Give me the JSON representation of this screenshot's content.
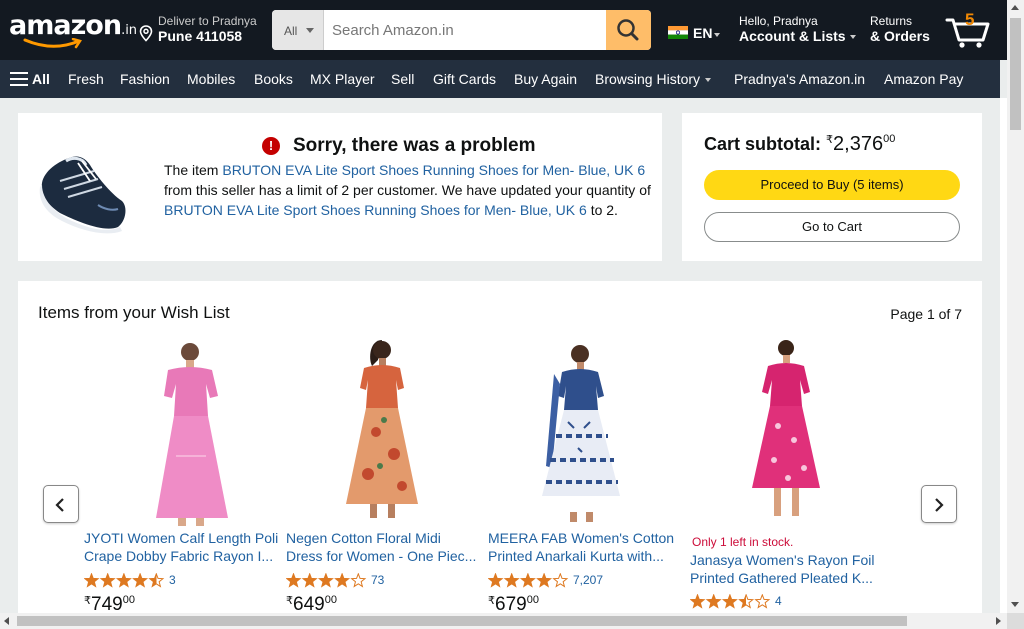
{
  "header": {
    "logo_text": "amazon",
    "logo_suffix": ".in",
    "deliver_line1": "Deliver to Pradnya",
    "deliver_line2": "Pune 411058",
    "search_category": "All",
    "search_placeholder": "Search Amazon.in",
    "language": "EN",
    "account_line1": "Hello, Pradnya",
    "account_line2": "Account & Lists",
    "returns_line1": "Returns",
    "returns_line2": "& Orders",
    "cart_count": "5"
  },
  "nav": {
    "all": "All",
    "items": [
      "Fresh",
      "Fashion",
      "Mobiles",
      "Books",
      "MX Player",
      "Sell",
      "Gift Cards",
      "Buy Again",
      "Browsing History",
      "Pradnya's Amazon.in",
      "Amazon Pay"
    ]
  },
  "alert": {
    "title": "Sorry, there was a problem",
    "text_1": "The item ",
    "product_link_1": "BRUTON EVA Lite Sport Shoes Running Shoes for Men- Blue, UK 6",
    "text_2": " from this seller has a limit of 2 per customer. We have updated your quantity of ",
    "product_link_2": "BRUTON EVA Lite Sport Shoes Running Shoes for Men- Blue, UK 6",
    "text_3": " to 2."
  },
  "cart_box": {
    "subtotal_label": "Cart subtotal:",
    "currency": "₹",
    "amount": "2,376",
    "fraction": "00",
    "proceed_label": "Proceed to Buy (5 items)",
    "goto_cart_label": "Go to Cart"
  },
  "wishlist": {
    "title": "Items from your Wish List",
    "page_label": "Page 1 of 7",
    "products": [
      {
        "name_line1": "JYOTI Women Calf Length Poli",
        "name_line2": "Crape Dobby Fabric Rayon I...",
        "rating": 4.5,
        "reviews": "3",
        "currency": "₹",
        "price": "749",
        "fraction": "00",
        "stock": ""
      },
      {
        "name_line1": "Negen Cotton Floral Midi",
        "name_line2": "Dress for Women - One Piec...",
        "rating": 4.0,
        "reviews": "73",
        "currency": "₹",
        "price": "649",
        "fraction": "00",
        "stock": ""
      },
      {
        "name_line1": "MEERA FAB Women's Cotton",
        "name_line2": "Printed Anarkali Kurta with...",
        "rating": 4.0,
        "reviews": "7,207",
        "currency": "₹",
        "price": "679",
        "fraction": "00",
        "stock": ""
      },
      {
        "name_line1": "Janasya Women's Rayon Foil",
        "name_line2": "Printed Gathered Pleated K...",
        "rating": 3.5,
        "reviews": "4",
        "currency": "₹",
        "price": "",
        "fraction": "",
        "stock": "Only 1 left in stock."
      }
    ]
  },
  "colors": {
    "header_bg": "#131921",
    "nav_bg": "#232f3e",
    "search_button": "#febd69",
    "proceed_button": "#ffd814",
    "link": "#2162a1",
    "star": "#de7921",
    "error_red": "#c40000"
  }
}
